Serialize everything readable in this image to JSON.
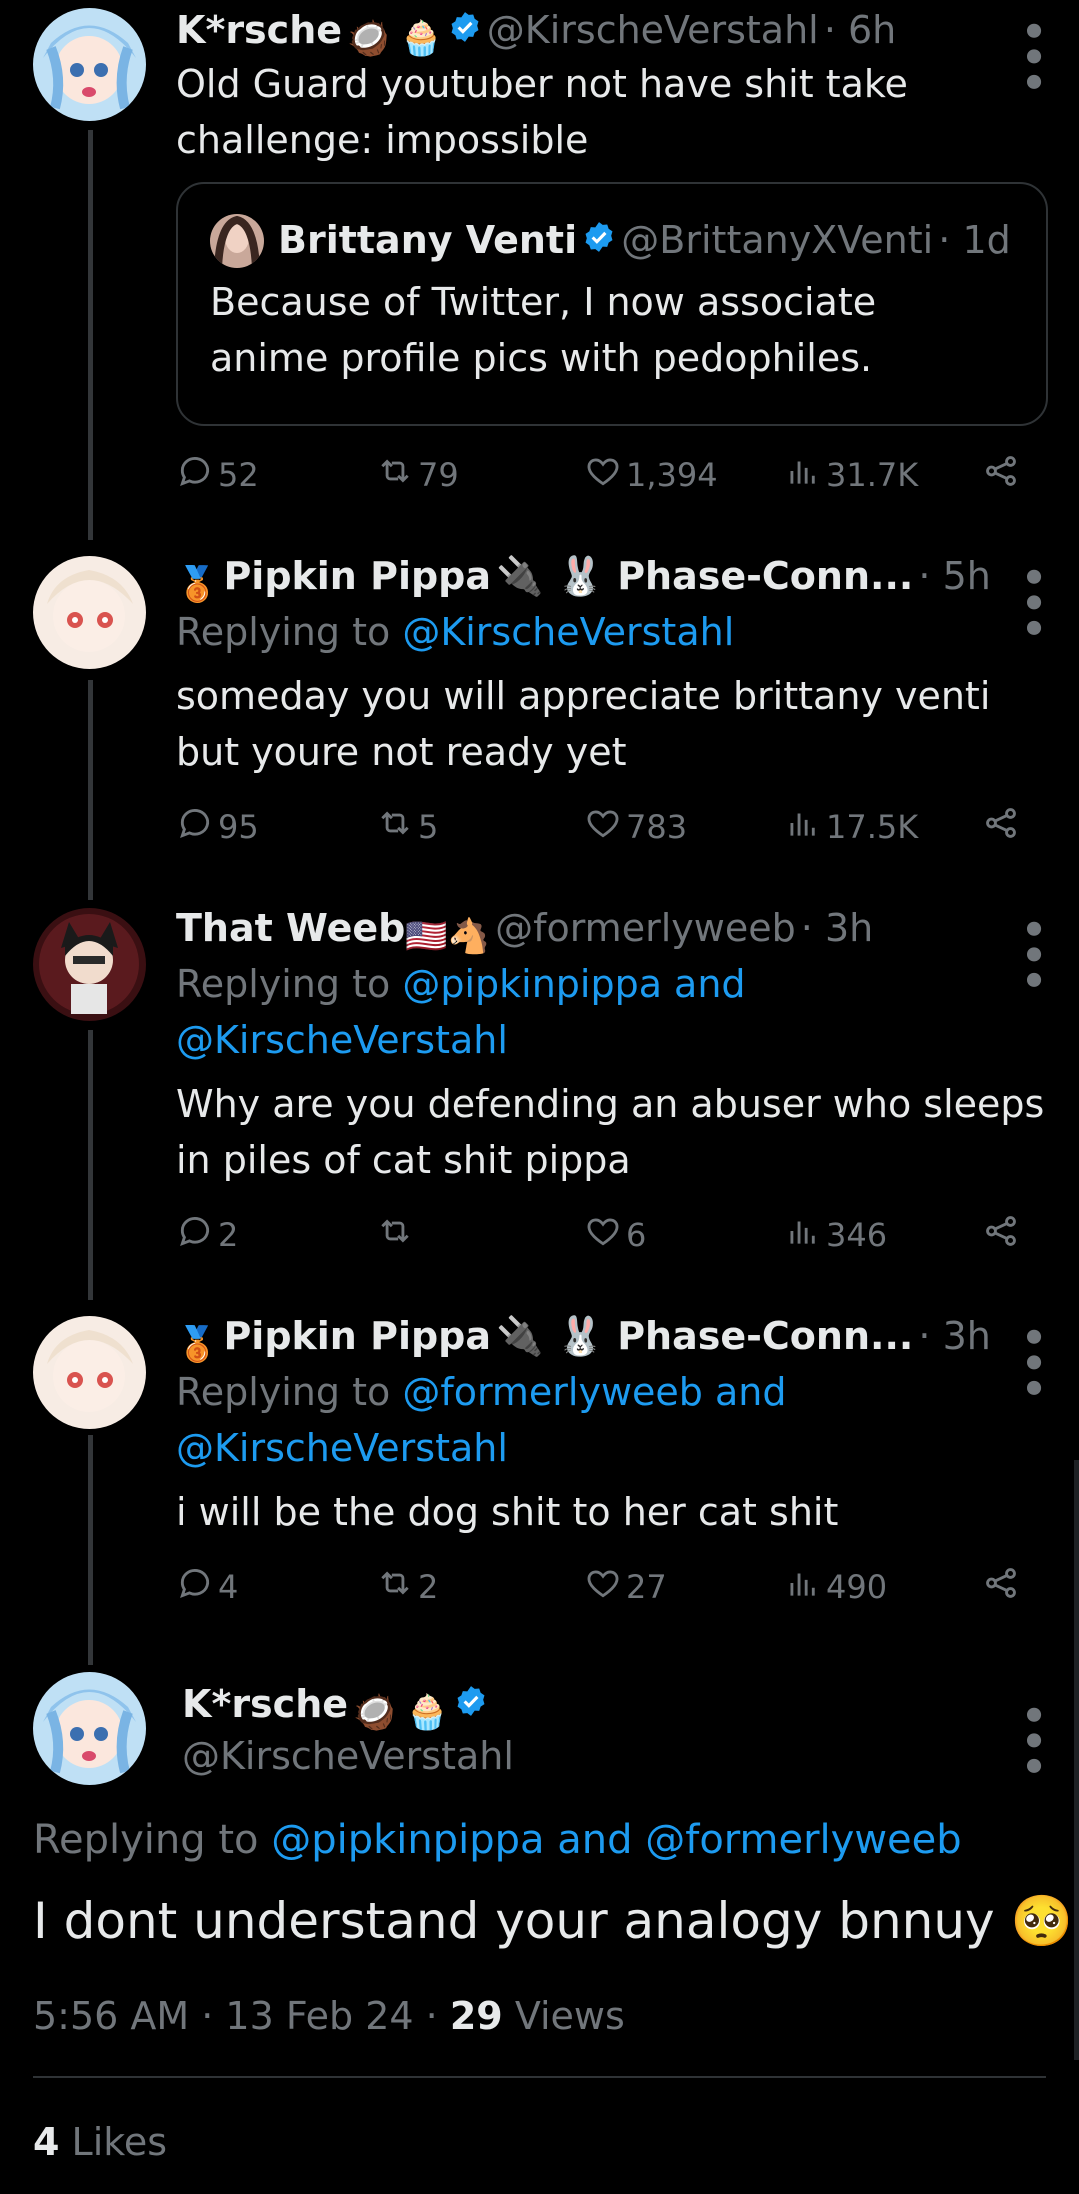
{
  "tweets": [
    {
      "name": "K*rsche",
      "emojis": "🥥 🧁",
      "handle": "@KirscheVerstahl",
      "time": "· 6h",
      "body1": "Old Guard youtuber not have shit take",
      "body2": "challenge: impossible",
      "quote": {
        "name": "Brittany Venti",
        "handle": "@BrittanyXVenti",
        "time": "· 1d",
        "body1": "Because of Twitter,  I now associate",
        "body2": "anime profile pics with pedophiles."
      },
      "replies": "52",
      "reposts": "79",
      "likes": "1,394",
      "views": "31.7K"
    },
    {
      "medal": "🥉",
      "name": "Pipkin Pippa",
      "name_suffix": "🔌 🐰 Phase-Conn...",
      "time": "· 5h",
      "replying_label": "Replying to",
      "replying_to": "@KirscheVerstahl",
      "body1": "someday you will appreciate brittany venti",
      "body2": "but youre not ready yet",
      "replies": "95",
      "reposts": "5",
      "likes": "783",
      "views": "17.5K"
    },
    {
      "name": "That Weeb",
      "flags": "🇺🇸🐴",
      "handle": "@formerlyweeb",
      "time": "· 3h",
      "replying_label": "Replying to",
      "replying_to1": "@pipkinpippa and",
      "replying_to2": "@KirscheVerstahl",
      "body1": "Why are you defending an abuser who sleeps",
      "body2": "in piles of cat shit pippa",
      "replies": "2",
      "reposts": "",
      "likes": "6",
      "views": "346"
    },
    {
      "medal": "🥉",
      "name": "Pipkin Pippa",
      "name_suffix": "🔌 🐰 Phase-Conn...",
      "time": "· 3h",
      "replying_label": "Replying to",
      "replying_to1": "@formerlyweeb and",
      "replying_to2": "@KirscheVerstahl",
      "body1": "i will be the dog shit to her cat shit",
      "replies": "4",
      "reposts": "2",
      "likes": "27",
      "views": "490"
    }
  ],
  "main": {
    "name": "K*rsche",
    "emojis": "🥥 🧁",
    "handle": "@KirscheVerstahl",
    "replying_label": "Replying to",
    "replying_to": "@pipkinpippa and @formerlyweeb",
    "body": "I dont understand your analogy bnnuy",
    "body_emoji": "🥺",
    "time": "5:56 AM · 13 Feb 24 ·",
    "views_count": "29",
    "views_label": "Views",
    "likes_count": "4",
    "likes_label": "Likes"
  },
  "colors": {
    "accent": "#1d9bf0",
    "muted": "#71767b",
    "background": "#000000"
  }
}
